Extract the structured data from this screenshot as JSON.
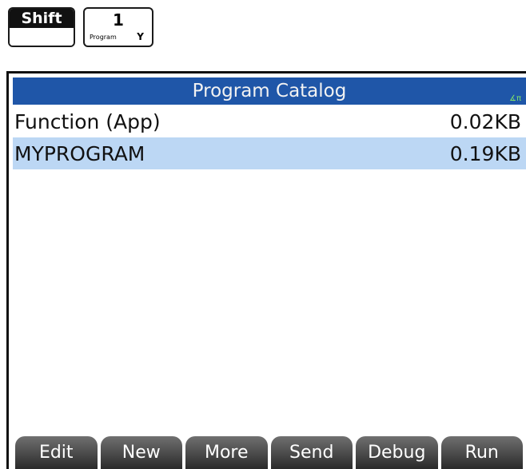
{
  "keys": {
    "shift_label": "Shift",
    "key1_digit": "1",
    "key1_shift_label": "Program",
    "key1_alpha_label": "Y"
  },
  "screen": {
    "title": "Program Catalog",
    "angle_indicator": "∡π"
  },
  "programs": [
    {
      "name": "Function (App)",
      "size": "0.02KB"
    },
    {
      "name": "MYPROGRAM",
      "size": "0.19KB"
    }
  ],
  "softkeys": [
    "Edit",
    "New",
    "More",
    "Send",
    "Debug",
    "Run"
  ],
  "colors": {
    "title_bar": "#1f56a8",
    "selection": "#bcd7f4",
    "indicator": "#7ee06a"
  }
}
